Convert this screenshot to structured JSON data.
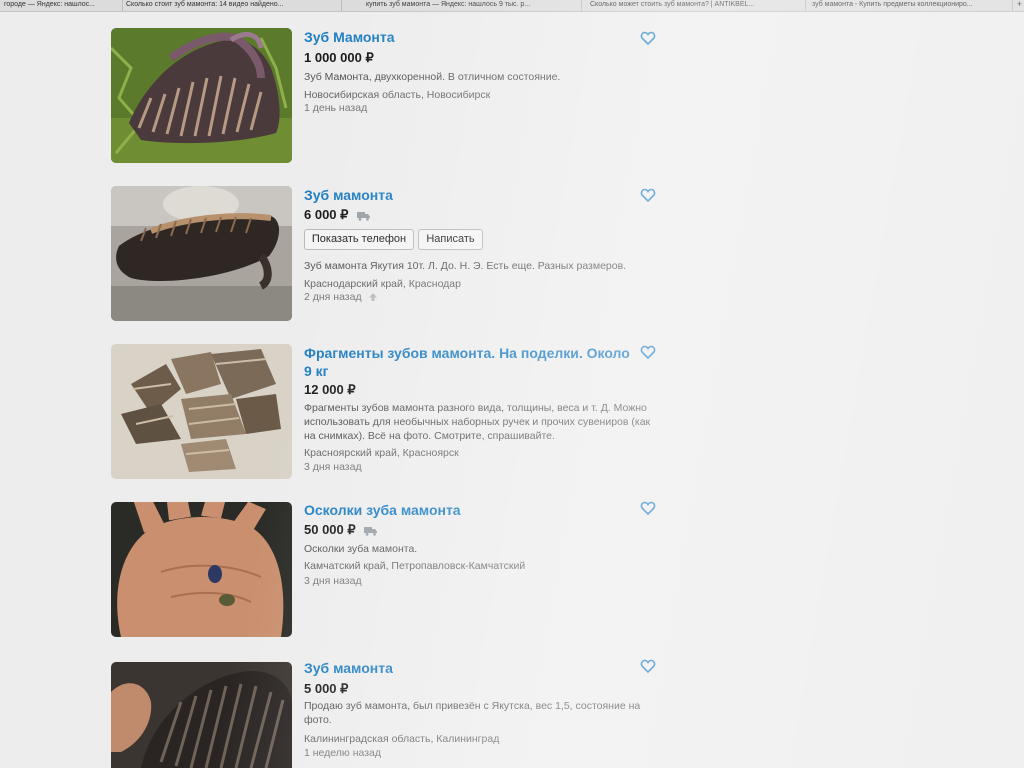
{
  "browser": {
    "tabs": [
      "городе — Яндекс: нашлос...",
      "Сколько стоит зуб мамонта: 14 видео найдено...",
      "купить зуб мамонта — Яндекс: нашлось 9 тыс. р...",
      "Сколько может стоить зуб мамонта? | ANTIKBEL...",
      "зуб мамонта - Купить предметы коллекциониро..."
    ],
    "new_tab_symbol": "+"
  },
  "actions": {
    "show_phone_label": "Показать телефон",
    "write_label": "Написать"
  },
  "listings": [
    {
      "title": "Зуб Мамонта",
      "price": "1 000 000 ₽",
      "description": "Зуб Мамонта, двухкоренной. В отличном состояние.",
      "location": "Новосибирская область, Новосибирск",
      "date": "1 день назад",
      "icons": [
        "heart-icon"
      ]
    },
    {
      "title": "Зуб мамонта",
      "price": "6 000 ₽",
      "description": "Зуб мамонта Якутия 10т. Л. До. Н. Э. Есть еще. Разных размеров.",
      "location": "Краснодарский край, Краснодар",
      "date": "2 дня назад",
      "icons": [
        "heart-icon",
        "delivery-truck-icon",
        "raise-arrow-icon"
      ]
    },
    {
      "title": "Фрагменты зубов мамонта. На поделки. Около 9 кг",
      "price": "12 000 ₽",
      "description": "Фрагменты зубов мамонта разного вида, толщины, веса и т. Д. Можно использовать для необычных наборных ручек и прочих сувениров (как на снимках). Всё на фото. Смотрите, спрашивайте.",
      "location": "Красноярский край, Красноярск",
      "date": "3 дня назад",
      "icons": [
        "heart-icon"
      ]
    },
    {
      "title": "Осколки зуба мамонта",
      "price": "50 000 ₽",
      "description": "Осколки зуба мамонта.",
      "location": "Камчатский край, Петропавловск-Камчатский",
      "date": "3 дня назад",
      "icons": [
        "heart-icon",
        "delivery-truck-icon"
      ]
    },
    {
      "title": "Зуб мамонта",
      "price": "5 000 ₽",
      "description": "Продаю зуб мамонта, был привезён с Якутска, вес 1,5, состояние на фото.",
      "location": "Калининградская область, Калининград",
      "date": "1 неделю назад",
      "icons": [
        "heart-icon"
      ]
    }
  ],
  "colors": {
    "title_link": "#1f7ec2",
    "heart_outline": "#2b86c8",
    "page_background": "#ededed"
  }
}
